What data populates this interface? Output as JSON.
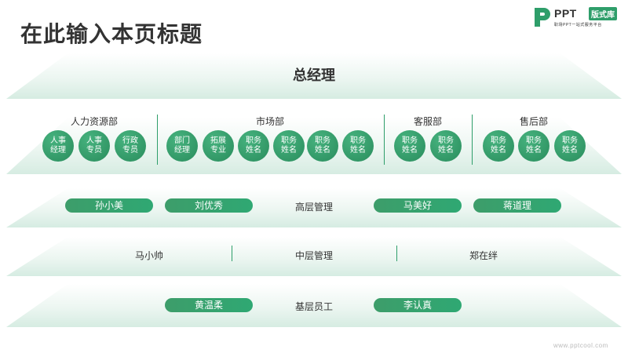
{
  "page_title": "在此输入本页标题",
  "logo": {
    "word": "PPT",
    "badge": "版式库",
    "subtitle": "职场PPT一站式服务平台"
  },
  "ceo": "总经理",
  "departments": [
    {
      "name": "人力资源部",
      "members": [
        [
          "人事",
          "经理"
        ],
        [
          "人事",
          "专员"
        ],
        [
          "行政",
          "专员"
        ]
      ]
    },
    {
      "name": "市场部",
      "members": [
        [
          "部门",
          "经理"
        ],
        [
          "拓展",
          "专业"
        ],
        [
          "职务",
          "姓名"
        ],
        [
          "职务",
          "姓名"
        ],
        [
          "职务",
          "姓名"
        ],
        [
          "职务",
          "姓名"
        ]
      ]
    },
    {
      "name": "客服部",
      "members": [
        [
          "职务",
          "姓名"
        ],
        [
          "职务",
          "姓名"
        ]
      ]
    },
    {
      "name": "售后部",
      "members": [
        [
          "职务",
          "姓名"
        ],
        [
          "职务",
          "姓名"
        ],
        [
          "职务",
          "姓名"
        ]
      ]
    }
  ],
  "senior": {
    "label": "高层管理",
    "names": [
      "孙小美",
      "刘优秀",
      "马美好",
      "蒋道理"
    ]
  },
  "middle": {
    "label": "中层管理",
    "names": [
      "马小帅",
      "郑在绊"
    ]
  },
  "base": {
    "label": "基层员工",
    "names": [
      "黄温柔",
      "李认真"
    ]
  },
  "watermark": "www.pptcool.com",
  "colors": {
    "accent": "#2e9e6a",
    "band": "#d6ece2"
  }
}
